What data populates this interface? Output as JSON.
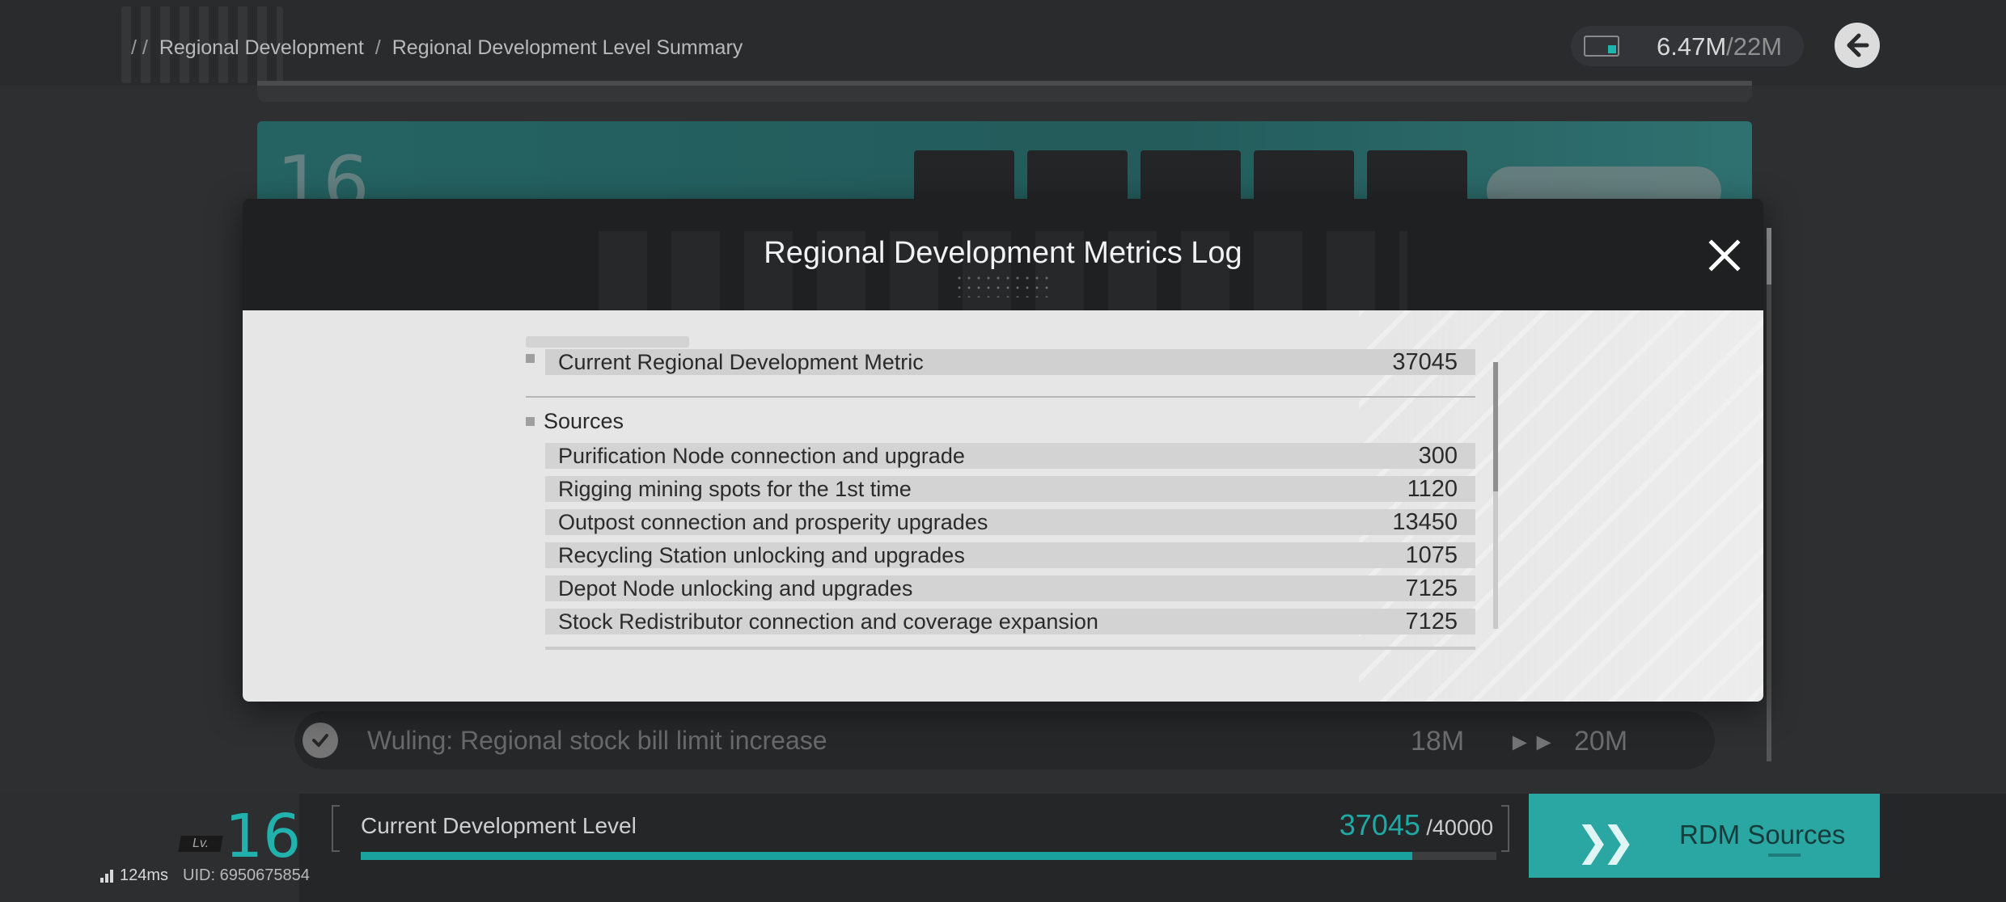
{
  "breadcrumb": {
    "lead_separators": "/ /",
    "items": [
      "Regional Development",
      "Regional Development Level Summary"
    ],
    "separator": "/"
  },
  "currency": {
    "icon": "stock-bill-icon",
    "current": "6.47M",
    "limit": "/22M"
  },
  "background": {
    "wuling_row": {
      "label": "Wuling: Regional stock bill limit increase",
      "from": "18M",
      "to": "20M"
    }
  },
  "modal": {
    "title": "Regional Development Metrics Log",
    "current_metric": {
      "label": "Current Regional Development Metric",
      "value": "37045"
    },
    "sources_title": "Sources",
    "sources": [
      {
        "label": "Purification Node connection and upgrade",
        "value": "300"
      },
      {
        "label": "Rigging mining spots for the 1st time",
        "value": "1120"
      },
      {
        "label": "Outpost connection and prosperity upgrades",
        "value": "13450"
      },
      {
        "label": "Recycling Station unlocking and upgrades",
        "value": "1075"
      },
      {
        "label": "Depot Node unlocking and upgrades",
        "value": "7125"
      },
      {
        "label": "Stock Redistributor connection and coverage expansion",
        "value": "7125"
      }
    ],
    "scroll_position": 0.0
  },
  "bottom": {
    "level_tag": "Lv.",
    "level": "16",
    "dev_label": "Current Development Level",
    "dev_current": "37045",
    "dev_max": "/40000",
    "progress": 0.926,
    "rdm_button": "RDM Sources"
  },
  "status": {
    "ping": "124ms",
    "uid": "UID: 6950675854"
  },
  "colors": {
    "accent": "#22b2ae",
    "modal_header": "#1f2021",
    "modal_body": "#e6e6e6"
  }
}
